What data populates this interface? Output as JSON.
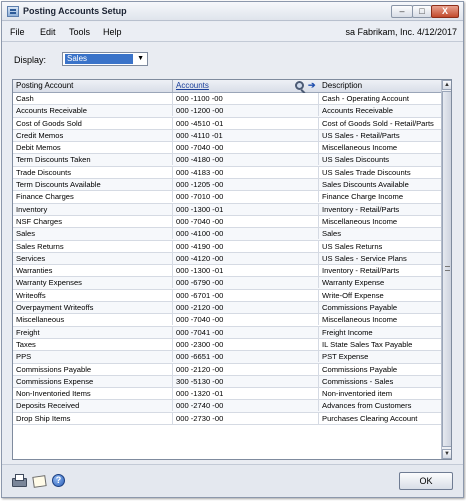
{
  "window": {
    "title": "Posting Accounts Setup"
  },
  "controls": {
    "minimize": "–",
    "maximize": "□",
    "close": "X"
  },
  "menu": {
    "items": [
      "File",
      "Edit",
      "Tools",
      "Help"
    ],
    "user_info": "sa  Fabrikam, Inc.  4/12/2017"
  },
  "display": {
    "label": "Display:",
    "value": "Sales"
  },
  "grid": {
    "columns": [
      "Posting Account",
      "Accounts",
      "Description"
    ],
    "rows": [
      {
        "posting_account": "Cash",
        "account": "000 -1100 -00",
        "description": "Cash - Operating Account"
      },
      {
        "posting_account": "Accounts Receivable",
        "account": "000 -1200 -00",
        "description": "Accounts Receivable"
      },
      {
        "posting_account": "Cost of Goods Sold",
        "account": "000 -4510 -01",
        "description": "Cost of Goods Sold - Retail/Parts"
      },
      {
        "posting_account": "Credit Memos",
        "account": "000 -4110 -01",
        "description": "US Sales - Retail/Parts"
      },
      {
        "posting_account": "Debit Memos",
        "account": "000 -7040 -00",
        "description": "Miscellaneous Income"
      },
      {
        "posting_account": "Term Discounts Taken",
        "account": "000 -4180 -00",
        "description": "US Sales Discounts"
      },
      {
        "posting_account": "Trade Discounts",
        "account": "000 -4183 -00",
        "description": "US Sales Trade Discounts"
      },
      {
        "posting_account": "Term Discounts Available",
        "account": "000 -1205 -00",
        "description": "Sales Discounts Available"
      },
      {
        "posting_account": "Finance Charges",
        "account": "000 -7010 -00",
        "description": "Finance Charge Income"
      },
      {
        "posting_account": "Inventory",
        "account": "000 -1300 -01",
        "description": "Inventory - Retail/Parts"
      },
      {
        "posting_account": "NSF Charges",
        "account": "000 -7040 -00",
        "description": "Miscellaneous Income"
      },
      {
        "posting_account": "Sales",
        "account": "000 -4100 -00",
        "description": "Sales"
      },
      {
        "posting_account": "Sales Returns",
        "account": "000 -4190 -00",
        "description": "US Sales Returns"
      },
      {
        "posting_account": "Services",
        "account": "000 -4120 -00",
        "description": "US Sales - Service Plans"
      },
      {
        "posting_account": "Warranties",
        "account": "000 -1300 -01",
        "description": "Inventory - Retail/Parts"
      },
      {
        "posting_account": "Warranty Expenses",
        "account": "000 -6790 -00",
        "description": "Warranty Expense"
      },
      {
        "posting_account": "Writeoffs",
        "account": "000 -6701 -00",
        "description": "Write-Off Expense"
      },
      {
        "posting_account": "Overpayment Writeoffs",
        "account": "000 -2120 -00",
        "description": "Commissions Payable"
      },
      {
        "posting_account": "Miscellaneous",
        "account": "000 -7040 -00",
        "description": "Miscellaneous Income"
      },
      {
        "posting_account": "Freight",
        "account": "000 -7041 -00",
        "description": "Freight Income"
      },
      {
        "posting_account": "Taxes",
        "account": "000 -2300 -00",
        "description": "IL State Sales Tax Payable"
      },
      {
        "posting_account": "PPS",
        "account": "000 -6651 -00",
        "description": "PST Expense"
      },
      {
        "posting_account": "Commissions Payable",
        "account": "000 -2120 -00",
        "description": "Commissions Payable"
      },
      {
        "posting_account": "Commissions Expense",
        "account": "300 -5130 -00",
        "description": "Commissions - Sales"
      },
      {
        "posting_account": "Non-Inventoried Items",
        "account": "000 -1320 -01",
        "description": "Non-inventoried item"
      },
      {
        "posting_account": "Deposits Received",
        "account": "000 -2740 -00",
        "description": "Advances from Customers"
      },
      {
        "posting_account": "Drop Ship Items",
        "account": "000 -2730 -00",
        "description": "Purchases Clearing Account"
      }
    ]
  },
  "footer": {
    "ok_label": "OK",
    "help_glyph": "?"
  },
  "colors": {
    "selection": "#3a73c9",
    "link": "#1a3f9a",
    "window_bg": "#e9ecf2"
  }
}
